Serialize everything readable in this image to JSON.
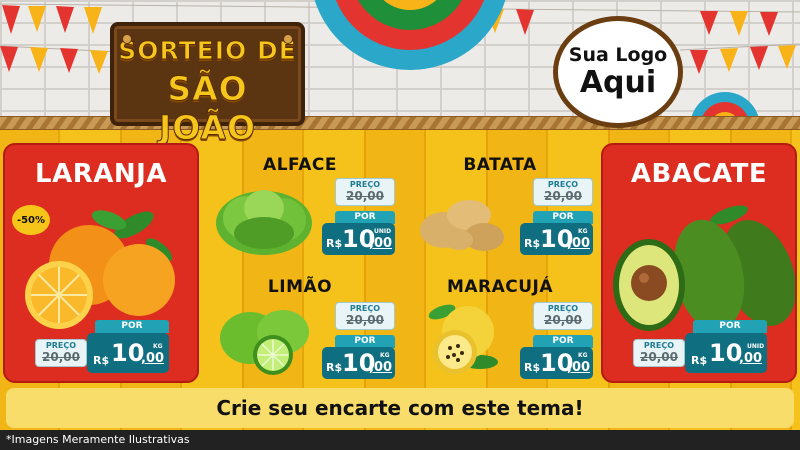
{
  "header": {
    "sign_line1": "SORTEIO DE",
    "sign_line2": "SÃO JOÃO",
    "logo_line1": "Sua Logo",
    "logo_line2": "Aqui"
  },
  "products": {
    "laranja": {
      "name": "LARANJA",
      "discount": "-50%",
      "preco_label": "PREÇO",
      "old_price": "20,00",
      "por_label": "POR",
      "currency": "R$",
      "price_int": "10",
      "price_cents": ",00",
      "unit": "KG"
    },
    "alface": {
      "name": "ALFACE",
      "preco_label": "PREÇO",
      "old_price": "20,00",
      "por_label": "POR",
      "currency": "R$",
      "price_int": "10",
      "price_cents": ",00",
      "unit": "UNID"
    },
    "batata": {
      "name": "BATATA",
      "preco_label": "PREÇO",
      "old_price": "20,00",
      "por_label": "POR",
      "currency": "R$",
      "price_int": "10",
      "price_cents": ",00",
      "unit": "KG"
    },
    "limao": {
      "name": "LIMÃO",
      "preco_label": "PREÇO",
      "old_price": "20,00",
      "por_label": "POR",
      "currency": "R$",
      "price_int": "10",
      "price_cents": ",00",
      "unit": "KG"
    },
    "maracuja": {
      "name": "MARACUJÁ",
      "preco_label": "PREÇO",
      "old_price": "20,00",
      "por_label": "POR",
      "currency": "R$",
      "price_int": "10",
      "price_cents": ",00",
      "unit": "KG"
    },
    "abacate": {
      "name": "ABACATE",
      "preco_label": "PREÇO",
      "old_price": "20,00",
      "por_label": "POR",
      "currency": "R$",
      "price_int": "10",
      "price_cents": ",00",
      "unit": "UNID"
    }
  },
  "banner_text": "Crie seu encarte com este tema!",
  "footer_text": "*Imagens Meramente Ilustrativas",
  "colors": {
    "red_panel": "#dc2d20",
    "wood": "#f2b516",
    "price_dark": "#0f6e80",
    "price_light": "#22a3b5",
    "banner": "#f8dd6b"
  }
}
